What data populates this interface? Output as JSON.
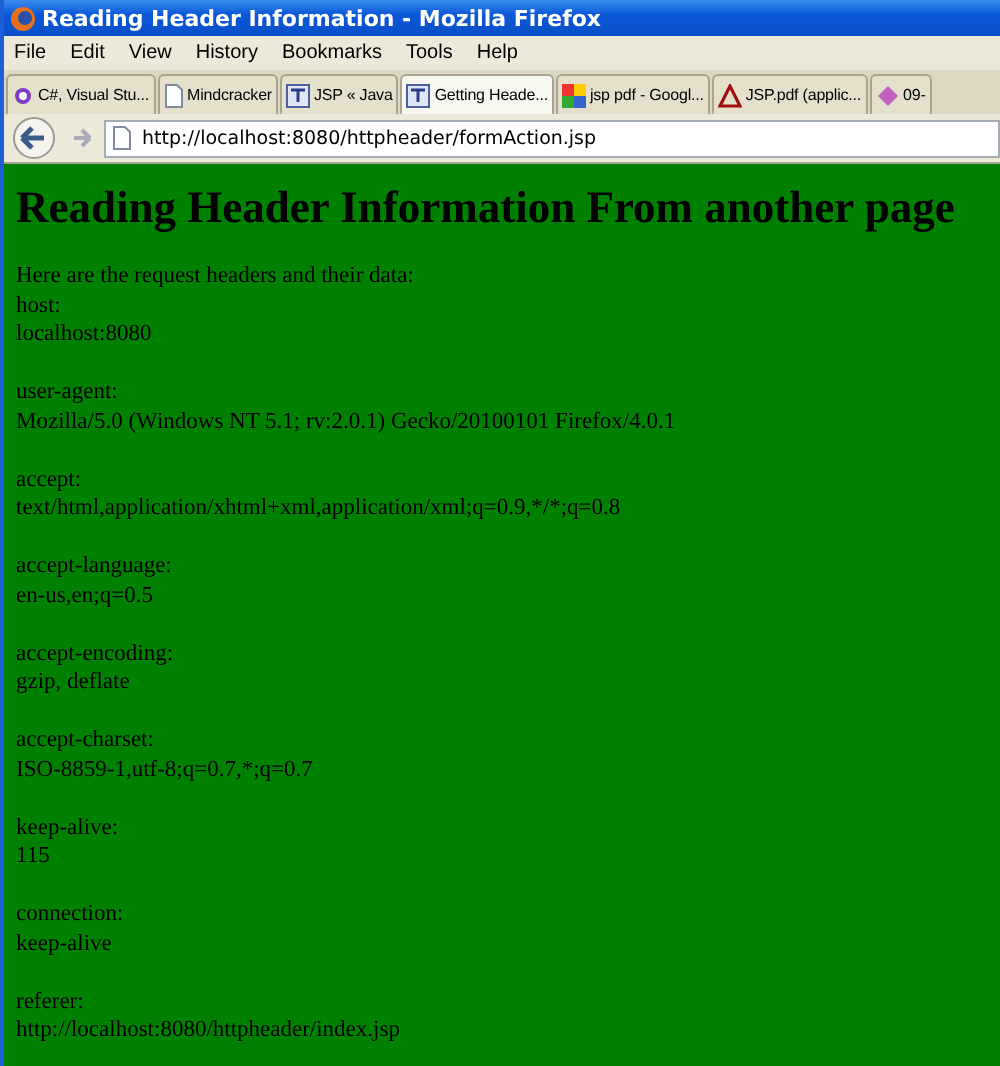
{
  "window": {
    "title": "Reading Header Information - Mozilla Firefox"
  },
  "menu": [
    "File",
    "Edit",
    "View",
    "History",
    "Bookmarks",
    "Tools",
    "Help"
  ],
  "tabs": [
    {
      "label": "C#, Visual Stu...",
      "kind": "purple",
      "selected": false
    },
    {
      "label": "Mindcracker",
      "kind": "page",
      "selected": false
    },
    {
      "label": "JSP « Java",
      "kind": "tj",
      "selected": false
    },
    {
      "label": "Getting Heade...",
      "kind": "tj",
      "selected": true
    },
    {
      "label": "jsp pdf - Googl...",
      "kind": "google",
      "selected": false
    },
    {
      "label": "JSP.pdf (applic...",
      "kind": "pdf",
      "selected": false
    },
    {
      "label": "09-",
      "kind": "puzzle",
      "selected": false
    }
  ],
  "address_bar": {
    "url": "http://localhost:8080/httpheader/formAction.jsp"
  },
  "page": {
    "heading": "Reading Header Information From another page",
    "intro": "Here are the request headers and their data:",
    "headers": [
      {
        "name": "host:",
        "value": "localhost:8080"
      },
      {
        "name": "user-agent:",
        "value": "Mozilla/5.0 (Windows NT 5.1; rv:2.0.1) Gecko/20100101 Firefox/4.0.1"
      },
      {
        "name": "accept:",
        "value": "text/html,application/xhtml+xml,application/xml;q=0.9,*/*;q=0.8"
      },
      {
        "name": "accept-language:",
        "value": "en-us,en;q=0.5"
      },
      {
        "name": "accept-encoding:",
        "value": "gzip, deflate"
      },
      {
        "name": "accept-charset:",
        "value": "ISO-8859-1,utf-8;q=0.7,*;q=0.7"
      },
      {
        "name": "keep-alive:",
        "value": "115"
      },
      {
        "name": "connection:",
        "value": "keep-alive"
      },
      {
        "name": "referer:",
        "value": "http://localhost:8080/httpheader/index.jsp"
      }
    ]
  }
}
